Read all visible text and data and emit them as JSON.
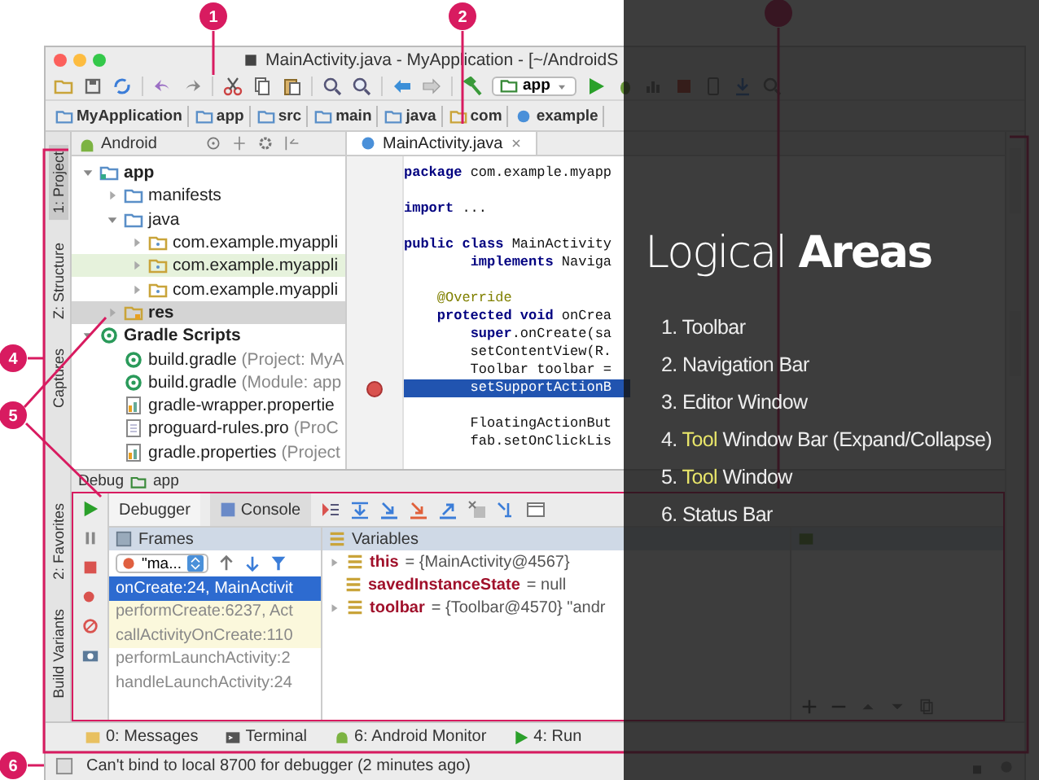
{
  "window": {
    "title": "MainActivity.java - MyApplication - [~/AndroidS"
  },
  "toolbar": {
    "run_config": "app"
  },
  "navigation_bar": [
    "MyApplication",
    "app",
    "src",
    "main",
    "java",
    "com",
    "example"
  ],
  "left_tool_bar": [
    {
      "label": "1: Project",
      "selected": true
    },
    {
      "label": "Z: Structure",
      "selected": false
    },
    {
      "label": "Captures",
      "selected": false
    },
    {
      "label": "2: Favorites",
      "selected": false
    },
    {
      "label": "Build Variants",
      "selected": false
    }
  ],
  "project": {
    "view": "Android",
    "tree": [
      {
        "label": "app",
        "kind": "module",
        "expanded": true,
        "selected": false,
        "highlighted": false,
        "children": [
          {
            "label": "manifests",
            "kind": "folder",
            "expanded": false,
            "selected": false,
            "highlighted": false
          },
          {
            "label": "java",
            "kind": "folder",
            "expanded": true,
            "selected": false,
            "highlighted": false,
            "children": [
              {
                "label": "com.example.myappli",
                "kind": "package",
                "expanded": false,
                "selected": false,
                "highlighted": false
              },
              {
                "label": "com.example.myappli",
                "kind": "package",
                "expanded": false,
                "selected": false,
                "highlighted": true
              },
              {
                "label": "com.example.myappli",
                "kind": "package",
                "expanded": false,
                "selected": false,
                "highlighted": false
              }
            ]
          },
          {
            "label": "res",
            "kind": "res",
            "expanded": false,
            "selected": true,
            "highlighted": false
          }
        ]
      },
      {
        "label": "Gradle Scripts",
        "kind": "gradle",
        "expanded": true,
        "selected": false,
        "highlighted": false,
        "children": [
          {
            "label": "build.gradle",
            "note": "(Project: MyA",
            "kind": "gradle",
            "selected": false,
            "highlighted": false
          },
          {
            "label": "build.gradle",
            "note": "(Module: app",
            "kind": "gradle",
            "selected": false,
            "highlighted": false
          },
          {
            "label": "gradle-wrapper.propertie",
            "kind": "properties",
            "selected": false,
            "highlighted": false
          },
          {
            "label": "proguard-rules.pro",
            "note": "(ProC",
            "kind": "file",
            "selected": false,
            "highlighted": false
          },
          {
            "label": "gradle.properties",
            "note": "(Project",
            "kind": "properties",
            "selected": false,
            "highlighted": false
          }
        ]
      }
    ]
  },
  "editor": {
    "tabs": [
      {
        "label": "MainActivity.java",
        "selected": true
      }
    ],
    "lines": [
      {
        "text": "**package** com.example.myapp",
        "kind": "code",
        "current": false
      },
      {
        "kind": "blank"
      },
      {
        "text": "**import** ...",
        "kind": "code",
        "current": false
      },
      {
        "kind": "blank"
      },
      {
        "text": "**public class** MainActivity",
        "kind": "code",
        "current": false
      },
      {
        "text": "        **implements** Naviga",
        "kind": "code",
        "current": false
      },
      {
        "kind": "blank"
      },
      {
        "text": "    @Override",
        "kind": "annotation",
        "current": false
      },
      {
        "text": "    **protected void** onCrea",
        "kind": "code",
        "current": false
      },
      {
        "text": "        **super**.onCreate(sa",
        "kind": "code",
        "current": false
      },
      {
        "text": "        setContentView(R.",
        "kind": "code",
        "current": false
      },
      {
        "text": "        Toolbar toolbar =",
        "kind": "code",
        "current": false
      },
      {
        "text": "        setSupportActionB",
        "kind": "code",
        "current": true
      },
      {
        "kind": "blank"
      },
      {
        "text": "        FloatingActionBut",
        "kind": "code",
        "current": false
      },
      {
        "text": "        fab.setOnClickLis",
        "kind": "code",
        "current": false
      }
    ]
  },
  "debug": {
    "title": "Debug",
    "config": "app",
    "tabs": [
      {
        "label": "Debugger",
        "selected": true
      },
      {
        "label": "Console",
        "selected": false
      }
    ],
    "frames": {
      "title": "Frames",
      "thread": "\"ma...",
      "rows": [
        {
          "text": "onCreate:24, MainActivit",
          "selected": true,
          "highlighted": false
        },
        {
          "text": "performCreate:6237, Act",
          "selected": false,
          "highlighted": true
        },
        {
          "text": "callActivityOnCreate:110",
          "selected": false,
          "highlighted": true
        },
        {
          "text": "performLaunchActivity:2",
          "selected": false,
          "highlighted": false
        },
        {
          "text": "handleLaunchActivity:24",
          "selected": false,
          "highlighted": false
        }
      ]
    },
    "variables": {
      "title": "Variables",
      "rows": [
        {
          "name": "this",
          "value": "= {MainActivity@4567}",
          "expandable": true
        },
        {
          "name": "savedInstanceState",
          "value": "= null",
          "expandable": false
        },
        {
          "name": "toolbar",
          "value": "= {Toolbar@4570} \"andr",
          "expandable": true
        }
      ]
    }
  },
  "bottom_tabs": [
    {
      "label": "0: Messages",
      "kind": "messages",
      "selected": false
    },
    {
      "label": "Terminal",
      "kind": "terminal",
      "selected": false
    },
    {
      "label": "6: Android Monitor",
      "kind": "android",
      "selected": false
    },
    {
      "label": "4: Run",
      "kind": "run",
      "selected": false
    }
  ],
  "status_bar": {
    "message": "Can't bind to local 8700 for debugger (2 minutes ago)"
  },
  "callouts": [
    "1",
    "2",
    "4",
    "5",
    "6"
  ],
  "slide": {
    "title": "Logical **Areas**",
    "items": [
      {
        "number": "1.",
        "text": "Toolbar"
      },
      {
        "number": "2.",
        "text": "Navigation Bar"
      },
      {
        "number": "3.",
        "text": "Editor Window"
      },
      {
        "number": "4.",
        "accent": "Tool",
        "text": "Window Bar (Expand/Collapse)"
      },
      {
        "number": "5.",
        "accent": "Tool",
        "text": "Window"
      },
      {
        "number": "6.",
        "text": "Status Bar"
      }
    ]
  }
}
